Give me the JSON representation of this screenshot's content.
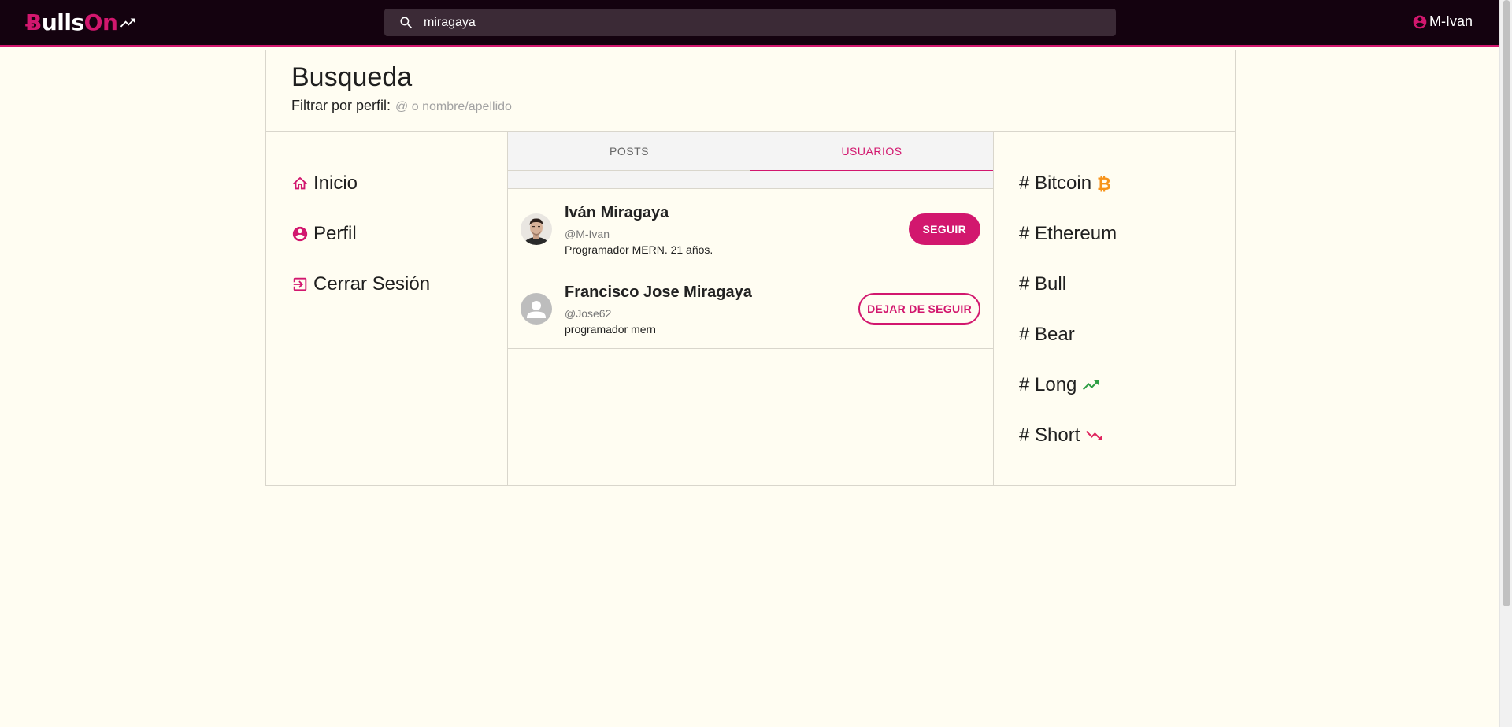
{
  "brand": {
    "logo_b": "Ƀ",
    "logo_ulls": "ulls",
    "logo_on": "On",
    "logo_icon": "trending-up-icon",
    "accent": "#d2176e",
    "topbar_bg": "#14020f"
  },
  "search": {
    "value": "miragaya",
    "icon": "search-icon"
  },
  "user": {
    "username": "M-Ivan",
    "icon": "account-circle-icon"
  },
  "page": {
    "title": "Busqueda",
    "filter_label": "Filtrar por perfil:",
    "filter_placeholder": "@ o nombre/apellido"
  },
  "nav": [
    {
      "label": "Inicio",
      "icon": "home-icon"
    },
    {
      "label": "Perfil",
      "icon": "account-circle-icon"
    },
    {
      "label": "Cerrar Sesión",
      "icon": "logout-icon"
    }
  ],
  "tabs": [
    {
      "label": "POSTS",
      "active": false
    },
    {
      "label": "USUARIOS",
      "active": true
    }
  ],
  "users": [
    {
      "name": "Iván Miragaya",
      "handle": "@M-Ivan",
      "bio": "Programador MERN. 21 años.",
      "button": "SEGUIR",
      "avatar": "photo"
    },
    {
      "name": "Francisco Jose Miragaya",
      "handle": "@Jose62",
      "bio": "programador mern",
      "button": "DEJAR DE SEGUIR",
      "avatar": "default-person-icon"
    }
  ],
  "tags": [
    {
      "label": "# Bitcoin",
      "icon": "bitcoin-icon",
      "icon_color": "#f7931a"
    },
    {
      "label": "# Ethereum"
    },
    {
      "label": "# Bull"
    },
    {
      "label": "# Bear"
    },
    {
      "label": "# Long",
      "icon": "trending-up-icon",
      "icon_color": "#2e9e44"
    },
    {
      "label": "# Short",
      "icon": "trending-down-icon",
      "icon_color": "#e0245e"
    }
  ]
}
